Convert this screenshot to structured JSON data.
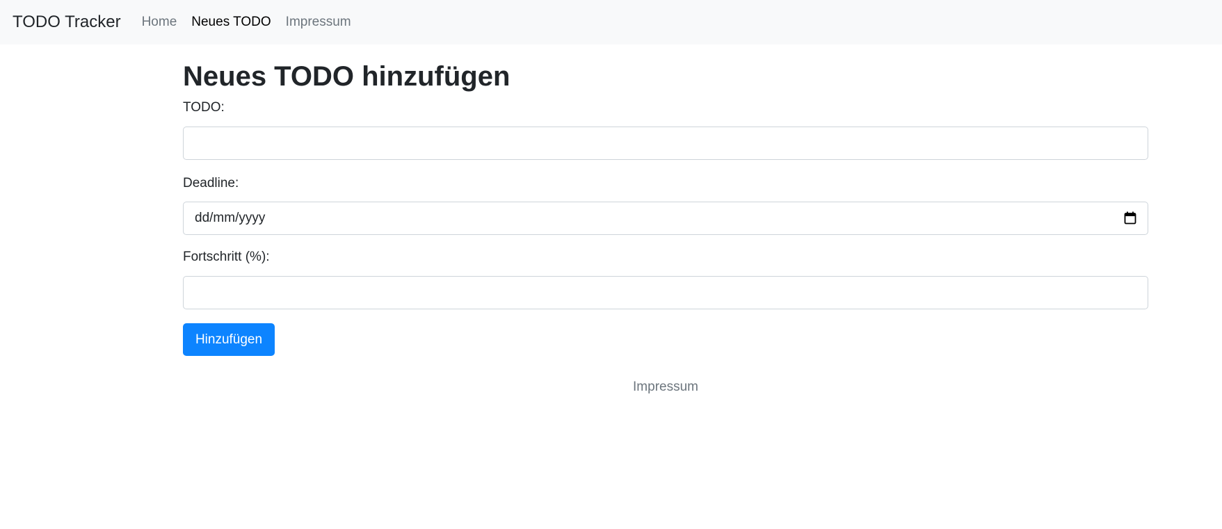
{
  "navbar": {
    "brand": "TODO Tracker",
    "links": [
      {
        "label": "Home",
        "active": false
      },
      {
        "label": "Neues TODO",
        "active": true
      },
      {
        "label": "Impressum",
        "active": false
      }
    ]
  },
  "main": {
    "title": "Neues TODO hinzufügen",
    "fields": {
      "todo": {
        "label": "TODO:",
        "value": ""
      },
      "deadline": {
        "label": "Deadline:",
        "placeholder": "dd/mm/yyyy",
        "icon": "calendar-icon"
      },
      "progress": {
        "label": "Fortschritt (%):",
        "value": ""
      }
    },
    "submit_label": "Hinzufügen"
  },
  "footer": {
    "link_label": "Impressum"
  },
  "colors": {
    "navbar_bg": "#f8f9fa",
    "primary": "#0d84ff",
    "muted_link": "#6c757d",
    "text": "#212529",
    "input_border": "#ced4da"
  }
}
